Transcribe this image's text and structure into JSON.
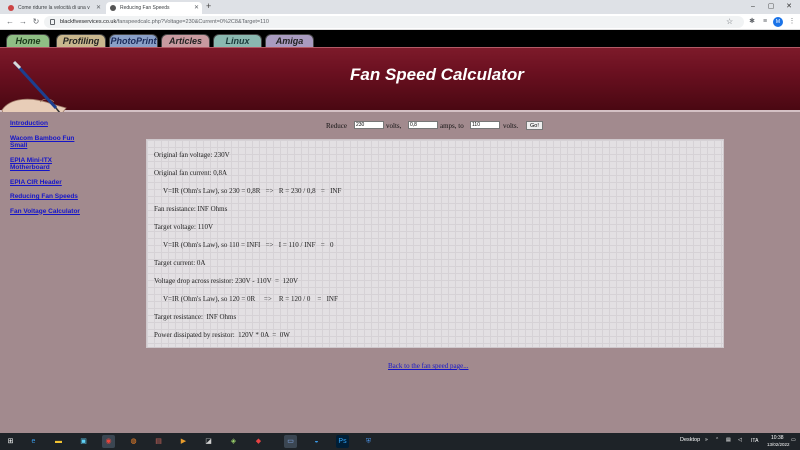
{
  "browser": {
    "tabs": [
      {
        "title": "Come ridurre la velocità di una v"
      },
      {
        "title": "Reducing Fan Speeds"
      }
    ],
    "new_tab": "+",
    "url_domain": "blackfiveservices.co.uk",
    "url_path": "/fanspeedcalc.php?Voltage=230&Current=0%2C8&Target=110",
    "profile_letter": "M"
  },
  "site": {
    "nav": [
      "Home",
      "Profiling",
      "PhotoPrint",
      "Articles",
      "Linux",
      "Amiga"
    ],
    "title": "Fan Speed Calculator",
    "sidebar": [
      "Introduction",
      "Wacom Bamboo Fun Small",
      "EPIA Mini-ITX Motherboard",
      "EPIA CIR Header",
      "Reducing Fan Speeds",
      "Fan Voltage Calculator"
    ]
  },
  "form": {
    "reduce_label": "Reduce",
    "voltage_value": "230",
    "volts_label": "volts,",
    "current_value": "0,8",
    "amps_label": "amps, to",
    "target_value": "110",
    "volts_label2": "volts.",
    "go_label": "Go!"
  },
  "results": [
    "Original fan voltage: 230V",
    "Original fan current: 0,8A",
    "V=IR (Ohm's Law), so 230 = 0,8R   =>   R = 230 / 0,8   =   INF",
    "Fan resistance: INF Ohms",
    "Target voltage: 110V",
    "V=IR (Ohm's Law), so 110 = INFI   =>   I = 110 / INF   =   0",
    "Target current: 0A",
    "Voltage drop across resistor: 230V - 110V  =  120V",
    "V=IR (Ohm's Law), so 120 = 0R     =>    R = 120 / 0    =   INF",
    "Target resistance:  INF Ohms",
    "Power dissipated by resistor:  120V * 0A  =  0W"
  ],
  "back_link": "Back to the fan speed page...",
  "taskbar": {
    "desktop_label": "Desktop",
    "lang": "ITA",
    "time": "10:38",
    "date": "13/02/2022"
  }
}
